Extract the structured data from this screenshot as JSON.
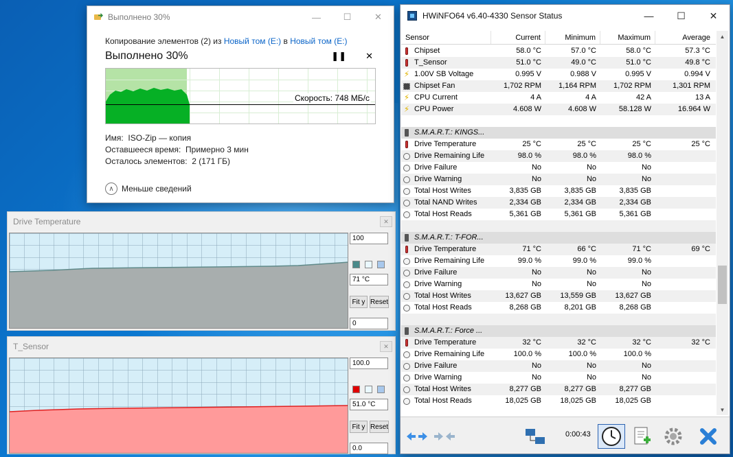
{
  "copy_dialog": {
    "title": "Выполнено 30%",
    "line_prefix": "Копирование элементов (2) из ",
    "source": "Новый том (E:)",
    "line_mid": " в ",
    "dest": "Новый том (E:)",
    "status": "Выполнено 30%",
    "progress_percent": 30,
    "pause_icon": "pause-icon",
    "cancel_icon": "close-icon",
    "speed": "Скорость: 748 МБ/с",
    "name_label": "Имя:",
    "name_value": "ISO-Zip — копия",
    "time_label": "Оставшееся время:",
    "time_value": "Примерно 3 мин",
    "items_label": "Осталось элементов:",
    "items_value": "2 (171 ГБ)",
    "less_label": "Меньше сведений",
    "accent": "#06b025"
  },
  "graph1": {
    "title": "Drive Temperature",
    "max": "100",
    "current": "71 °C",
    "min": "0",
    "fit_label": "Fit y",
    "reset_label": "Reset",
    "series_color": "#5f8a8a",
    "fill_color": "#a8aeae"
  },
  "graph2": {
    "title": "T_Sensor",
    "max": "100.0",
    "current": "51.0 °C",
    "min": "0.0",
    "fit_label": "Fit y",
    "reset_label": "Reset",
    "series_color": "#e02020",
    "fill_color": "#ff9a9a"
  },
  "hwinfo": {
    "title": "HWiNFO64 v6.40-4330 Sensor Status",
    "columns": [
      "Sensor",
      "Current",
      "Minimum",
      "Maximum",
      "Average"
    ],
    "rows": [
      {
        "icon": "thermometer-icon",
        "name": "Chipset",
        "cur": "58.0 °C",
        "min": "57.0 °C",
        "max": "58.0 °C",
        "avg": "57.3 °C"
      },
      {
        "icon": "thermometer-icon",
        "name": "T_Sensor",
        "cur": "51.0 °C",
        "min": "49.0 °C",
        "max": "51.0 °C",
        "avg": "49.8 °C"
      },
      {
        "icon": "bolt-icon",
        "name": "1.00V SB Voltage",
        "cur": "0.995 V",
        "min": "0.988 V",
        "max": "0.995 V",
        "avg": "0.994 V"
      },
      {
        "icon": "fan-icon",
        "name": "Chipset Fan",
        "cur": "1,702 RPM",
        "min": "1,164 RPM",
        "max": "1,702 RPM",
        "avg": "1,301 RPM"
      },
      {
        "icon": "bolt-icon",
        "name": "CPU Current",
        "cur": "4 A",
        "min": "4 A",
        "max": "42 A",
        "avg": "13 A"
      },
      {
        "icon": "bolt-icon",
        "name": "CPU Power",
        "cur": "4.608 W",
        "min": "4.608 W",
        "max": "58.128 W",
        "avg": "16.964 W"
      },
      {
        "icon": "",
        "name": "",
        "cur": "",
        "min": "",
        "max": "",
        "avg": ""
      },
      {
        "group": true,
        "icon": "drive-icon",
        "name": "S.M.A.R.T.: KINGS..."
      },
      {
        "icon": "thermometer-icon",
        "name": "Drive Temperature",
        "cur": "25 °C",
        "min": "25 °C",
        "max": "25 °C",
        "avg": "25 °C"
      },
      {
        "icon": "circle-icon",
        "name": "Drive Remaining Life",
        "cur": "98.0 %",
        "min": "98.0 %",
        "max": "98.0 %",
        "avg": ""
      },
      {
        "icon": "circle-icon",
        "name": "Drive Failure",
        "cur": "No",
        "min": "No",
        "max": "No",
        "avg": ""
      },
      {
        "icon": "circle-icon",
        "name": "Drive Warning",
        "cur": "No",
        "min": "No",
        "max": "No",
        "avg": ""
      },
      {
        "icon": "circle-icon",
        "name": "Total Host Writes",
        "cur": "3,835 GB",
        "min": "3,835 GB",
        "max": "3,835 GB",
        "avg": ""
      },
      {
        "icon": "circle-icon",
        "name": "Total NAND Writes",
        "cur": "2,334 GB",
        "min": "2,334 GB",
        "max": "2,334 GB",
        "avg": ""
      },
      {
        "icon": "circle-icon",
        "name": "Total Host Reads",
        "cur": "5,361 GB",
        "min": "5,361 GB",
        "max": "5,361 GB",
        "avg": ""
      },
      {
        "icon": "",
        "name": "",
        "cur": "",
        "min": "",
        "max": "",
        "avg": ""
      },
      {
        "group": true,
        "icon": "drive-icon",
        "name": "S.M.A.R.T.: T-FOR..."
      },
      {
        "icon": "thermometer-icon",
        "name": "Drive Temperature",
        "cur": "71 °C",
        "min": "66 °C",
        "max": "71 °C",
        "avg": "69 °C"
      },
      {
        "icon": "circle-icon",
        "name": "Drive Remaining Life",
        "cur": "99.0 %",
        "min": "99.0 %",
        "max": "99.0 %",
        "avg": ""
      },
      {
        "icon": "circle-icon",
        "name": "Drive Failure",
        "cur": "No",
        "min": "No",
        "max": "No",
        "avg": ""
      },
      {
        "icon": "circle-icon",
        "name": "Drive Warning",
        "cur": "No",
        "min": "No",
        "max": "No",
        "avg": ""
      },
      {
        "icon": "circle-icon",
        "name": "Total Host Writes",
        "cur": "13,627 GB",
        "min": "13,559 GB",
        "max": "13,627 GB",
        "avg": ""
      },
      {
        "icon": "circle-icon",
        "name": "Total Host Reads",
        "cur": "8,268 GB",
        "min": "8,201 GB",
        "max": "8,268 GB",
        "avg": ""
      },
      {
        "icon": "",
        "name": "",
        "cur": "",
        "min": "",
        "max": "",
        "avg": ""
      },
      {
        "group": true,
        "icon": "drive-icon",
        "name": "S.M.A.R.T.: Force ..."
      },
      {
        "icon": "thermometer-icon",
        "name": "Drive Temperature",
        "cur": "32 °C",
        "min": "32 °C",
        "max": "32 °C",
        "avg": "32 °C"
      },
      {
        "icon": "circle-icon",
        "name": "Drive Remaining Life",
        "cur": "100.0 %",
        "min": "100.0 %",
        "max": "100.0 %",
        "avg": ""
      },
      {
        "icon": "circle-icon",
        "name": "Drive Failure",
        "cur": "No",
        "min": "No",
        "max": "No",
        "avg": ""
      },
      {
        "icon": "circle-icon",
        "name": "Drive Warning",
        "cur": "No",
        "min": "No",
        "max": "No",
        "avg": ""
      },
      {
        "icon": "circle-icon",
        "name": "Total Host Writes",
        "cur": "8,277 GB",
        "min": "8,277 GB",
        "max": "8,277 GB",
        "avg": ""
      },
      {
        "icon": "circle-icon",
        "name": "Total Host Reads",
        "cur": "18,025 GB",
        "min": "18,025 GB",
        "max": "18,025 GB",
        "avg": ""
      }
    ],
    "timer": "0:00:43",
    "footer_icons": [
      "arrows-left-right-icon",
      "arrows-right-left-icon",
      "network-icon",
      "clock-icon",
      "add-report-icon",
      "settings-icon",
      "close-x-icon"
    ]
  }
}
